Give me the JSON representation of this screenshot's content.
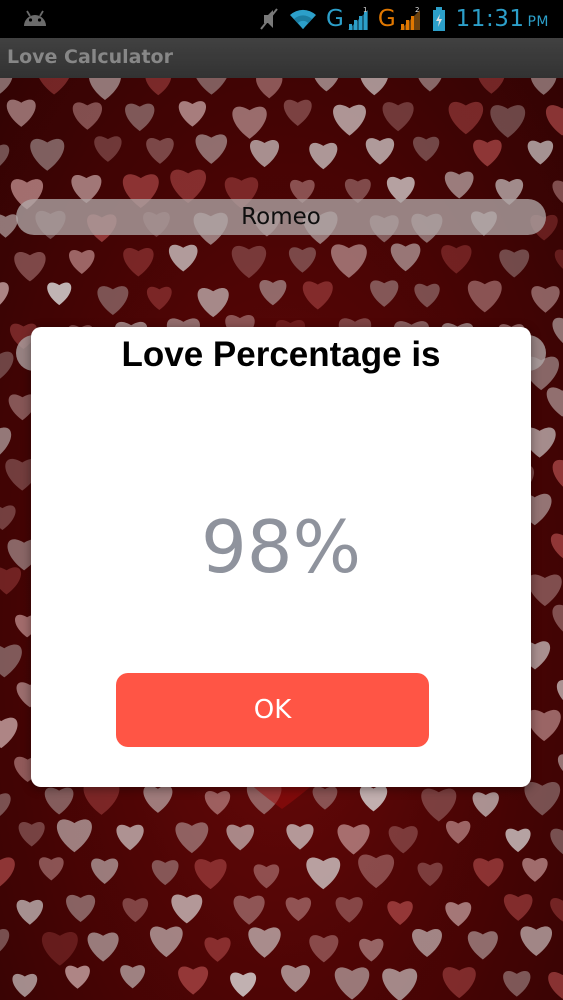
{
  "status_bar": {
    "network_1": "G",
    "network_2": "G",
    "sim_1": "1",
    "sim_2": "2",
    "time": "11:31",
    "ampm": "PM",
    "icons": [
      "android-icon",
      "mute-icon",
      "wifi-icon",
      "signal-icon",
      "battery-icon"
    ],
    "accent_color": "#33b5e5",
    "warn_color": "#ff8800"
  },
  "app_bar": {
    "title": "Love Calculator"
  },
  "form": {
    "name_1": "Romeo",
    "name_2": ""
  },
  "dialog": {
    "title": "Love Percentage is",
    "value": "98%",
    "ok_label": "OK",
    "button_color": "#ff5545",
    "value_color": "#8f939d"
  }
}
